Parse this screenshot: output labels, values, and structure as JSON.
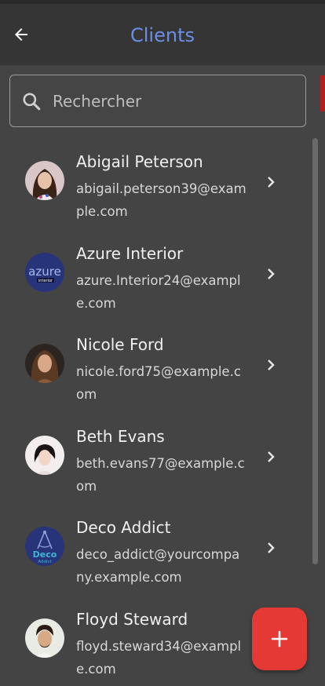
{
  "header": {
    "title": "Clients",
    "back_icon": "arrow-left-icon",
    "title_color": "#6b8ee6"
  },
  "search": {
    "placeholder": "Rechercher",
    "icon": "search-icon"
  },
  "clients": [
    {
      "name": "Abigail Peterson",
      "email": "abigail.peterson39@example.com",
      "avatar": "photo-woman-dark-hair"
    },
    {
      "name": "Azure Interior",
      "email": "azure.Interior24@example.com",
      "avatar": "azure-interior-logo",
      "logo_text": "azure",
      "logo_subtext": "interior"
    },
    {
      "name": "Nicole Ford",
      "email": "nicole.ford75@example.com",
      "avatar": "photo-woman-brown-hair"
    },
    {
      "name": "Beth Evans",
      "email": "beth.evans77@example.com",
      "avatar": "photo-woman-light"
    },
    {
      "name": "Deco Addict",
      "email": "deco_addict@yourcompany.example.com",
      "avatar": "deco-addict-logo",
      "logo_text": "Deco",
      "logo_subtext": "Addict"
    },
    {
      "name": "Floyd Steward",
      "email": "floyd.steward34@example.com",
      "avatar": "photo-man"
    }
  ],
  "fab": {
    "icon": "plus-icon",
    "color": "#e53935"
  },
  "colors": {
    "background": "#444444",
    "header": "#353535",
    "accent": "#6b8ee6"
  }
}
